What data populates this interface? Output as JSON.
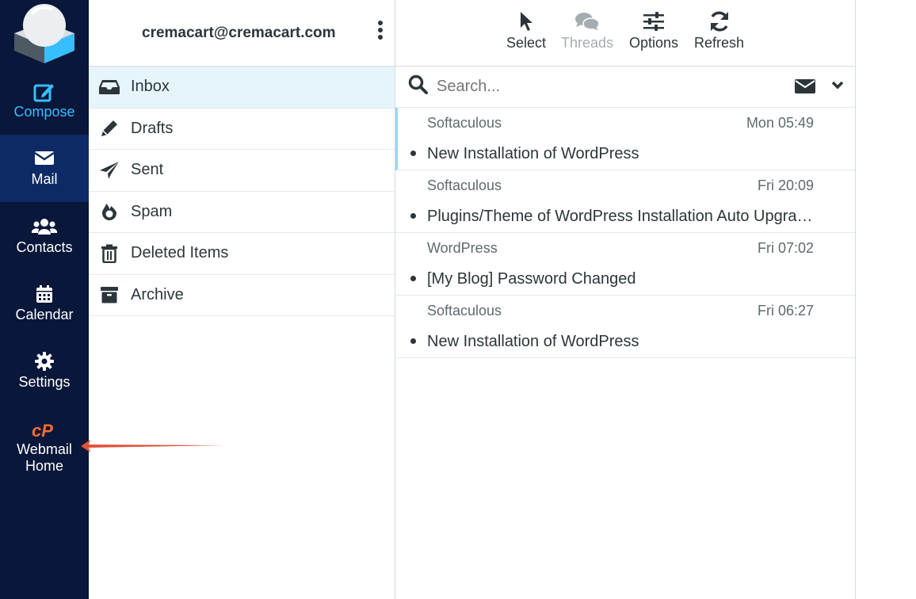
{
  "nav": {
    "compose": "Compose",
    "mail": "Mail",
    "contacts": "Contacts",
    "calendar": "Calendar",
    "settings": "Settings",
    "webmail_line1": "Webmail",
    "webmail_line2": "Home",
    "accent_color": "#37beff",
    "bg_color": "#08173a",
    "active_bg_color": "#0e2a66"
  },
  "account": {
    "email": "cremacart@cremacart.com"
  },
  "folders": [
    {
      "label": "Inbox",
      "icon": "inbox-icon"
    },
    {
      "label": "Drafts",
      "icon": "pencil-icon"
    },
    {
      "label": "Sent",
      "icon": "paper-plane-icon"
    },
    {
      "label": "Spam",
      "icon": "fire-icon"
    },
    {
      "label": "Deleted Items",
      "icon": "trash-icon"
    },
    {
      "label": "Archive",
      "icon": "archive-icon"
    }
  ],
  "toolbar": {
    "select": "Select",
    "threads": "Threads",
    "options": "Options",
    "refresh": "Refresh"
  },
  "search": {
    "placeholder": "Search..."
  },
  "messages": [
    {
      "from": "Softaculous",
      "date": "Mon 05:49",
      "subject": "New Installation of WordPress"
    },
    {
      "from": "Softaculous",
      "date": "Fri 20:09",
      "subject": "Plugins/Theme of WordPress Installation Auto Upgraded"
    },
    {
      "from": "WordPress",
      "date": "Fri 07:02",
      "subject": "[My Blog] Password Changed"
    },
    {
      "from": "Softaculous",
      "date": "Fri 06:27",
      "subject": "New Installation of WordPress"
    }
  ],
  "annotation": {
    "arrow_color": "#e0533a"
  }
}
